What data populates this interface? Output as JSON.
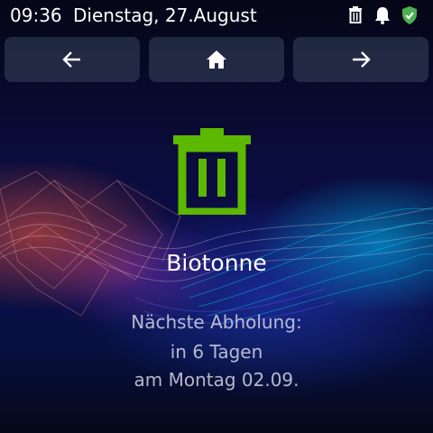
{
  "status_bar": {
    "time": "09:36",
    "date": "Dienstag, 27.August",
    "icons": [
      "trash-icon",
      "bell-icon",
      "shield-check-icon"
    ],
    "shield_color": "#4caf50"
  },
  "nav": {
    "back_icon": "arrow-left-icon",
    "home_icon": "home-icon",
    "forward_icon": "arrow-right-icon"
  },
  "main": {
    "icon": "trash-bin-icon",
    "icon_color": "#5cb800",
    "title": "Biotonne",
    "lines": [
      "Nächste Abholung:",
      "in 6 Tagen",
      "am Montag 02.09."
    ]
  }
}
